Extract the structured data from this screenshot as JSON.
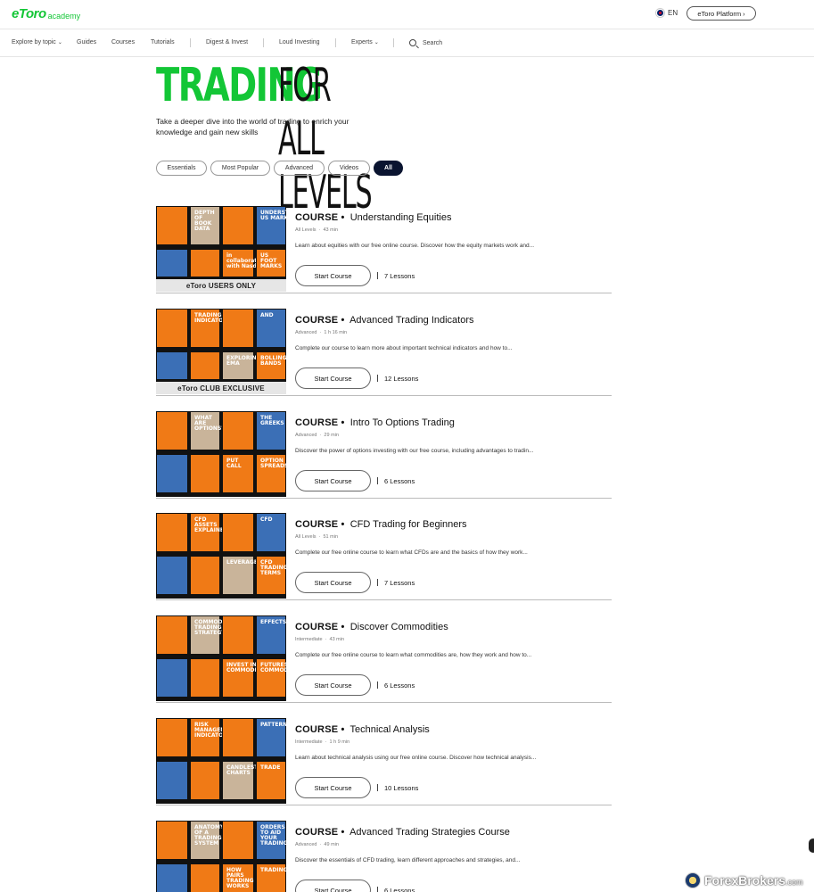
{
  "header": {
    "logo_main": "eToro",
    "logo_sub": "academy",
    "lang": "EN",
    "platform_button": "eToro Platform"
  },
  "nav": {
    "explore": "Explore by topic",
    "guides": "Guides",
    "courses": "Courses",
    "tutorials": "Tutorials",
    "digest": "Digest & Invest",
    "loud": "Loud Investing",
    "experts": "Experts",
    "search": "Search"
  },
  "hero": {
    "title_green": "TRADING",
    "title_dark": "FOR ALL LEVELS",
    "subtitle": "Take a deeper dive into the world of trading to enrich your knowledge and gain new skills"
  },
  "filters": [
    "Essentials",
    "Most Popular",
    "Advanced",
    "Videos",
    "All"
  ],
  "course_label": "COURSE •",
  "start_label": "Start Course",
  "courses": [
    {
      "title": "Understanding Equities",
      "level": "All Levels",
      "duration": "43 min",
      "desc": "Learn about equities with our free online course. Discover how the equity markets work and...",
      "lessons": "7 Lessons",
      "banner": "eToro USERS ONLY",
      "tiles": [
        "DEPTH OF BOOK DATA",
        "UNDERSTANDING US MARKETS",
        "in collaboration with Nasdaq",
        "US FOOT MARKS"
      ]
    },
    {
      "title": "Advanced Trading Indicators",
      "level": "Advanced",
      "duration": "1 h 16 min",
      "desc": "Complete our course to learn more about important technical indicators and how to...",
      "lessons": "12 Lessons",
      "banner": "eToro CLUB EXCLUSIVE",
      "tiles": [
        "TRADING INDICATORS",
        "AND",
        "EXPLORING EMA",
        "BOLLINGER BANDS"
      ]
    },
    {
      "title": "Intro To Options Trading",
      "level": "Advanced",
      "duration": "29 min",
      "desc": "Discover the power of options investing with our free course, including advantages to tradin...",
      "lessons": "6 Lessons",
      "banner": "",
      "tiles": [
        "WHAT ARE OPTIONS?",
        "THE GREEKS",
        "PUT CALL",
        "OPTION SPREADS"
      ]
    },
    {
      "title": "CFD Trading for Beginners",
      "level": "All Levels",
      "duration": "51 min",
      "desc": "Complete our free online course to learn what CFDs are and the basics of how they work...",
      "lessons": "7 Lessons",
      "banner": "",
      "tiles": [
        "CFD ASSETS EXPLAINED",
        "CFD",
        "LEVERAGE",
        "CFD TRADING TERMS"
      ]
    },
    {
      "title": "Discover Commodities",
      "level": "Intermediate",
      "duration": "43 min",
      "desc": "Complete our free online course to learn what commodities are, how they work and how to...",
      "lessons": "6 Lessons",
      "banner": "",
      "tiles": [
        "COMMODITIES TRADING STRATEGY",
        "EFFECTS",
        "INVEST IN COMMODITIES",
        "FUTURES VS COMMODITIES"
      ]
    },
    {
      "title": "Technical Analysis",
      "level": "Intermediate",
      "duration": "1 h 9 min",
      "desc": "Learn about technical analysis using our free online course. Discover how technical analysis...",
      "lessons": "10 Lessons",
      "banner": "",
      "tiles": [
        "RISK MANAGEMENT INDICATORS",
        "PATTERNS",
        "CANDLESTICK CHARTS",
        "TRADE"
      ]
    },
    {
      "title": "Advanced Trading Strategies Course",
      "level": "Advanced",
      "duration": "49 min",
      "desc": "Discover the essentials of CFD trading, learn different approaches and strategies, and...",
      "lessons": "6 Lessons",
      "banner": "",
      "tiles": [
        "ANATOMY OF A TRADING SYSTEM",
        "ORDERS TO AID YOUR TRADING",
        "HOW PAIRS TRADING WORKS",
        "TRADING"
      ]
    }
  ],
  "watermark": {
    "brand": "ForexBrokers",
    "suffix": ".com"
  }
}
